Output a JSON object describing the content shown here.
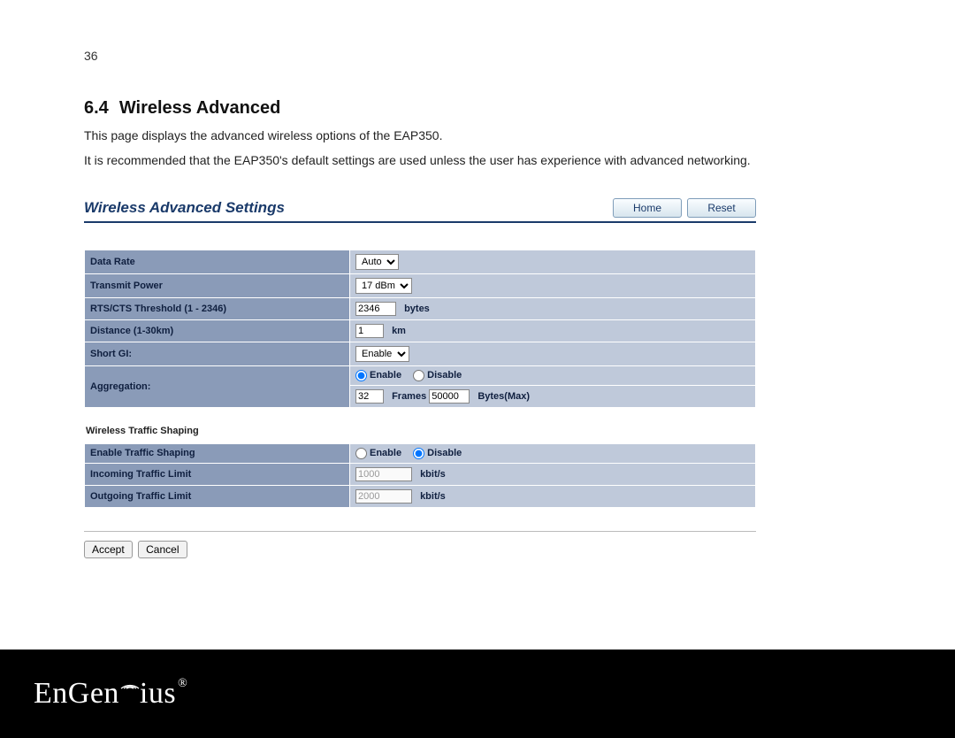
{
  "page_number": "36",
  "section": {
    "number": "6.4",
    "title": "Wireless Advanced"
  },
  "intro_line1": "This page displays the advanced wireless options of the EAP350.",
  "intro_line2": "It is recommended that the EAP350's default settings are used unless the user has experience with advanced networking.",
  "screenshot": {
    "title": "Wireless Advanced Settings",
    "buttons": {
      "home": "Home",
      "reset": "Reset"
    },
    "rows": {
      "data_rate": {
        "label": "Data Rate",
        "value": "Auto"
      },
      "transmit_power": {
        "label": "Transmit Power",
        "value": "17 dBm"
      },
      "rts": {
        "label": "RTS/CTS Threshold (1 - 2346)",
        "value": "2346",
        "unit": "bytes"
      },
      "distance": {
        "label": "Distance (1-30km)",
        "value": "1",
        "unit": "km"
      },
      "short_gi": {
        "label": "Short GI:",
        "value": "Enable"
      },
      "aggregation": {
        "label": "Aggregation:",
        "enable_label": "Enable",
        "disable_label": "Disable",
        "selected": "enable",
        "frames_value": "32",
        "frames_label": "Frames",
        "bytes_value": "50000",
        "bytes_label": "Bytes(Max)"
      }
    },
    "traffic_heading": "Wireless Traffic Shaping",
    "traffic": {
      "enable": {
        "label": "Enable Traffic Shaping",
        "enable_label": "Enable",
        "disable_label": "Disable",
        "selected": "disable"
      },
      "incoming": {
        "label": "Incoming Traffic Limit",
        "value": "1000",
        "unit": "kbit/s",
        "disabled": true
      },
      "outgoing": {
        "label": "Outgoing Traffic Limit",
        "value": "2000",
        "unit": "kbit/s",
        "disabled": true
      }
    },
    "actions": {
      "accept": "Accept",
      "cancel": "Cancel"
    }
  },
  "brand": {
    "part1": "EnGen",
    "part2": "ius",
    "reg": "®"
  }
}
